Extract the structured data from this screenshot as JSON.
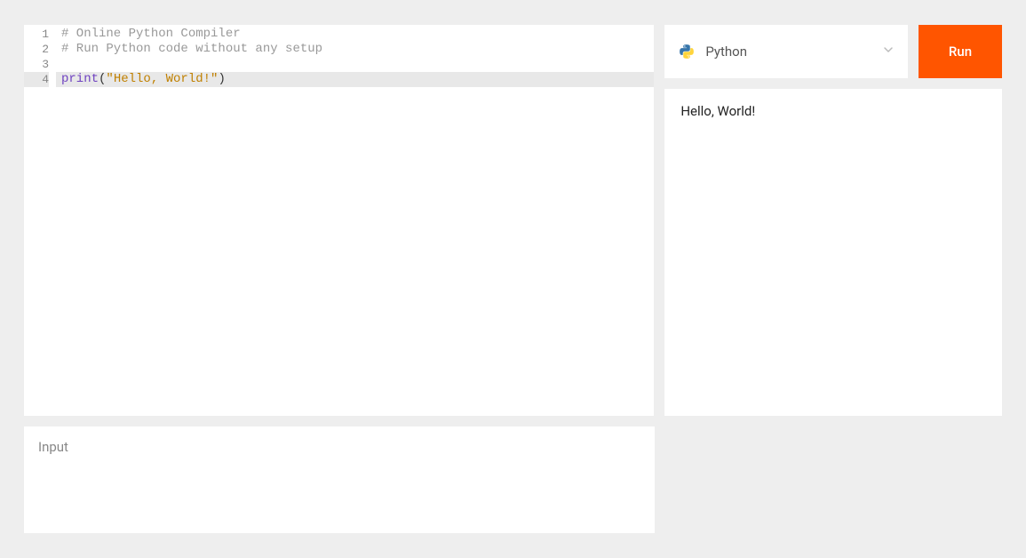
{
  "editor": {
    "lines": [
      {
        "num": "1",
        "tokens": [
          {
            "cls": "tok-comment",
            "text": "# Online Python Compiler"
          }
        ],
        "active": false
      },
      {
        "num": "2",
        "tokens": [
          {
            "cls": "tok-comment",
            "text": "# Run Python code without any setup"
          }
        ],
        "active": false
      },
      {
        "num": "3",
        "tokens": [],
        "active": false
      },
      {
        "num": "4",
        "tokens": [
          {
            "cls": "tok-builtin",
            "text": "print"
          },
          {
            "cls": "tok-punct",
            "text": "("
          },
          {
            "cls": "tok-string",
            "text": "\"Hello, World!\""
          },
          {
            "cls": "tok-punct",
            "text": ")"
          }
        ],
        "active": true
      }
    ]
  },
  "toolbar": {
    "language_label": "Python",
    "run_label": "Run"
  },
  "output": {
    "text": "Hello, World!"
  },
  "input": {
    "label": "Input"
  }
}
